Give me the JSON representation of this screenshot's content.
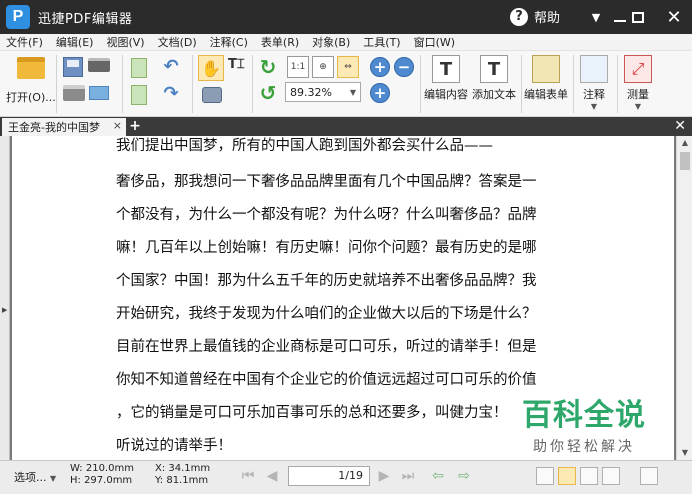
{
  "titlebar": {
    "app_logo": "P",
    "title": "迅捷PDF编辑器",
    "help_label": "帮助",
    "help_glyph": "?",
    "close_glyph": "✕",
    "dropdown_glyph": "▼"
  },
  "menu": [
    "文件(F)",
    "编辑(E)",
    "视图(V)",
    "文档(D)",
    "注释(C)",
    "表单(R)",
    "对象(B)",
    "工具(T)",
    "窗口(W)"
  ],
  "toolbar": {
    "open_label": "打开(O)...",
    "zoom_value": "89.32%",
    "fit_labels": [
      "1:1",
      "⊕",
      "⇔"
    ],
    "edit_content_label": "编辑内容",
    "add_text_label": "添加文本",
    "edit_form_label": "编辑表单",
    "annotate_label": "注释",
    "measure_label": "测量",
    "big_glyphs": [
      "T",
      "T"
    ]
  },
  "tabs": {
    "active_tab": "王金亮-我的中国梦",
    "tab_close": "×",
    "add_tab": "+",
    "close_all": "✕"
  },
  "document": {
    "lines": [
      "我们提出中国梦，所有的中国人跑到国外都会买什么品——",
      "奢侈品，那我想问一下奢侈品品牌里面有几个中国品牌？答案是一",
      "个都没有，为什么一个都没有呢？为什么呀？什么叫奢侈品？品牌",
      "嘛！几百年以上创始嘛！有历史嘛！问你个问题？最有历史的是哪",
      "个国家？中国！那为什么五千年的历史就培养不出奢侈品品牌？我",
      "开始研究，我终于发现为什么咱们的企业做大以后的下场是什么？",
      "目前在世界上最值钱的企业商标是可口可乐，听过的请举手！但是",
      "你知不知道曾经在中国有个企业它的价值远远超过可口可乐的价值",
      "，它的销量是可口可乐加百事可乐的总和还要多，叫健力宝！",
      "听说过的请举手！"
    ]
  },
  "watermark": {
    "brand": "百科全说",
    "slogan": "助你轻松解决"
  },
  "statusbar": {
    "select_label": "选项...",
    "width": "W: 210.0mm",
    "height": "H: 297.0mm",
    "x_coord": "X:   34.1mm",
    "y_coord": "Y:   81.1mm",
    "page_indicator": "1/19"
  }
}
